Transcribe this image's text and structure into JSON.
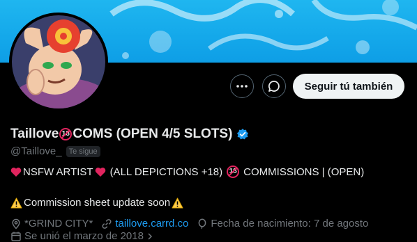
{
  "profile": {
    "display_name_part1": "Taillove",
    "display_name_badge": "18",
    "display_name_part2": "COMS (OPEN 4/5 SLOTS)",
    "handle": "@Taillove_",
    "follows_you": "Te sigue"
  },
  "actions": {
    "more_icon": "more-icon",
    "message_icon": "message-icon",
    "follow_label": "Seguir tú también"
  },
  "bio": {
    "line1_part1": "NSFW ARTIST",
    "line1_part2": "(ALL DEPICTIONS +18)",
    "line1_badge": "18",
    "line1_part3": "COMMISSIONS | (OPEN)",
    "line2": "Commission sheet update soon"
  },
  "meta": {
    "location": "*GRIND CITY*",
    "website": "taillove.carrd.co",
    "birthday": "Fecha de nacimiento: 7 de agosto",
    "joined": "Se unió el marzo de 2018"
  },
  "colors": {
    "accent": "#1d9bf0",
    "banner": "#14a8ea",
    "muted": "#71767b"
  }
}
